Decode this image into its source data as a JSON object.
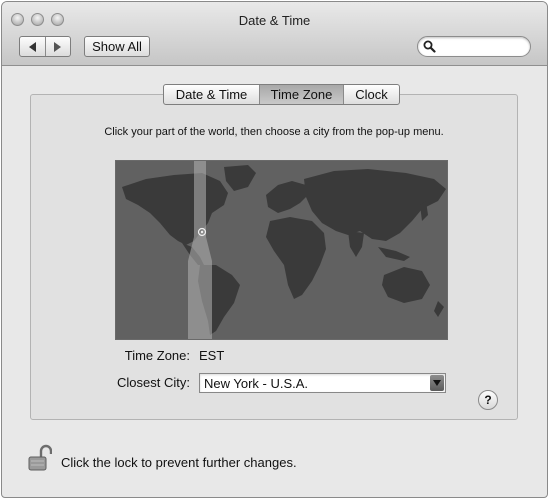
{
  "window": {
    "title": "Date & Time"
  },
  "toolbar": {
    "back_icon": "back-arrow-icon",
    "forward_icon": "forward-arrow-icon",
    "show_all_label": "Show All",
    "search": {
      "value": "",
      "icon": "search-icon"
    }
  },
  "tabs": [
    {
      "label": "Date & Time",
      "selected": false
    },
    {
      "label": "Time Zone",
      "selected": true
    },
    {
      "label": "Clock",
      "selected": false
    }
  ],
  "time_zone_pane": {
    "instruction": "Click your part of the world, then choose a city from the pop-up menu.",
    "time_zone_label": "Time Zone:",
    "time_zone_value": "EST",
    "closest_city_label": "Closest City:",
    "closest_city_value": "New York - U.S.A."
  },
  "help_label": "?",
  "lock": {
    "icon": "unlocked-padlock-icon",
    "text": "Click the lock to prevent further changes."
  },
  "colors": {
    "toolbar_top": "#e9e9e9",
    "toolbar_bottom": "#c6c6c6",
    "map_sea": "#616161",
    "map_land": "#3a3a3a",
    "tz_band": "#a9a9a9"
  }
}
